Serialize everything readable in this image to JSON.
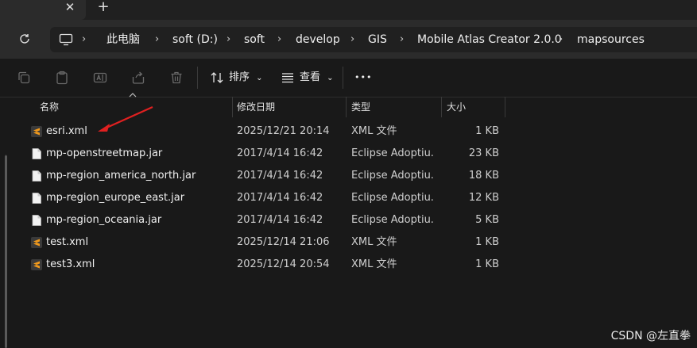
{
  "tabs": {
    "close_glyph": "✕",
    "new_tab_glyph": "+"
  },
  "address": {
    "crumbs": [
      "此电脑",
      "soft (D:)",
      "soft",
      "develop",
      "GIS",
      "Mobile Atlas Creator 2.0.0",
      "mapsources"
    ],
    "separator": "›"
  },
  "toolbar": {
    "sort_label": "排序",
    "view_label": "查看",
    "more_glyph": "•••",
    "dropdown_glyph": "⌄"
  },
  "columns": {
    "name": "名称",
    "date": "修改日期",
    "type": "类型",
    "size": "大小"
  },
  "files": [
    {
      "name": "esri.xml",
      "date": "2025/12/21 20:14",
      "type": "XML 文件",
      "size": "1 KB",
      "icon": "sublime-file-icon"
    },
    {
      "name": "mp-openstreetmap.jar",
      "date": "2017/4/14 16:42",
      "type": "Eclipse Adoptiu...",
      "size": "23 KB",
      "icon": "blank-file-icon"
    },
    {
      "name": "mp-region_america_north.jar",
      "date": "2017/4/14 16:42",
      "type": "Eclipse Adoptiu...",
      "size": "18 KB",
      "icon": "blank-file-icon"
    },
    {
      "name": "mp-region_europe_east.jar",
      "date": "2017/4/14 16:42",
      "type": "Eclipse Adoptiu...",
      "size": "12 KB",
      "icon": "blank-file-icon"
    },
    {
      "name": "mp-region_oceania.jar",
      "date": "2017/4/14 16:42",
      "type": "Eclipse Adoptiu...",
      "size": "5 KB",
      "icon": "blank-file-icon"
    },
    {
      "name": "test.xml",
      "date": "2025/12/14 21:06",
      "type": "XML 文件",
      "size": "1 KB",
      "icon": "sublime-file-icon"
    },
    {
      "name": "test3.xml",
      "date": "2025/12/14 20:54",
      "type": "XML 文件",
      "size": "1 KB",
      "icon": "sublime-file-icon"
    }
  ],
  "watermark": "CSDN @左直拳",
  "colors": {
    "background": "#191919",
    "address_row": "#2b2b2b",
    "annotation_arrow": "#e02020",
    "sublime_orange": "#f29a1c"
  }
}
